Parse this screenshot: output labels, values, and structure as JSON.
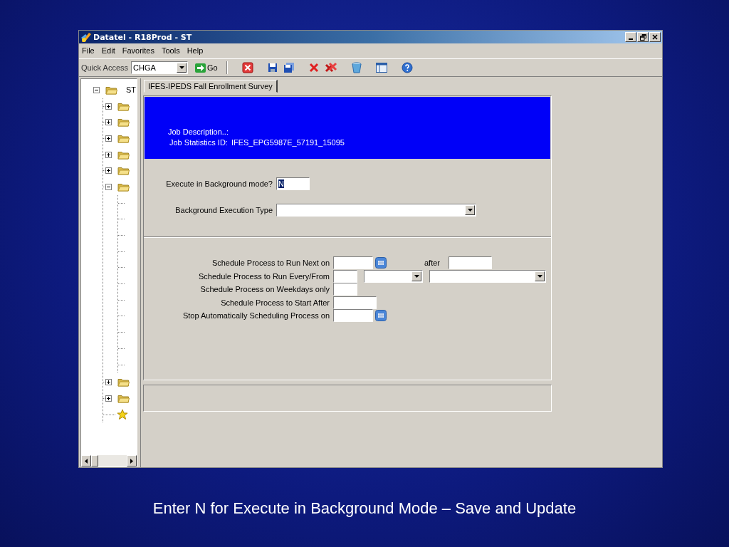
{
  "window": {
    "title": "Datatel - R18Prod - ST"
  },
  "menu": [
    {
      "label": "File"
    },
    {
      "label": "Edit"
    },
    {
      "label": "Favorites"
    },
    {
      "label": "Tools"
    },
    {
      "label": "Help"
    }
  ],
  "toolbar": {
    "quick_access_label": "Quick Access",
    "quick_access_value": "CHGA",
    "go_label": "Go"
  },
  "tree": {
    "label": "ST",
    "kind": "folder",
    "expanded": true,
    "children": [
      {
        "kind": "folder",
        "expanded": false
      },
      {
        "kind": "folder",
        "expanded": false
      },
      {
        "kind": "folder",
        "expanded": false
      },
      {
        "kind": "folder",
        "expanded": false
      },
      {
        "kind": "folder",
        "expanded": false
      },
      {
        "kind": "folder",
        "expanded": true,
        "children": [
          {
            "kind": "leaf"
          },
          {
            "kind": "leaf"
          },
          {
            "kind": "leaf"
          },
          {
            "kind": "leaf"
          },
          {
            "kind": "leaf"
          },
          {
            "kind": "leaf"
          },
          {
            "kind": "leaf"
          },
          {
            "kind": "leaf"
          },
          {
            "kind": "leaf"
          },
          {
            "kind": "leaf"
          },
          {
            "kind": "leaf"
          }
        ]
      },
      {
        "kind": "folder",
        "expanded": false
      },
      {
        "kind": "folder",
        "expanded": false
      },
      {
        "kind": "favorite"
      }
    ]
  },
  "tabs": [
    {
      "label": "IFES-IPEDS Fall Enrollment Survey",
      "selected": true
    }
  ],
  "header": {
    "job_description_label": "Job Description..:",
    "job_statistics_label": "Job Statistics ID:",
    "job_statistics_id": "IFES_EPG5987E_57191_15095"
  },
  "background": {
    "execute_label": "Execute in Background mode?",
    "execute_value": "N",
    "type_label": "Background Execution Type"
  },
  "schedule": [
    {
      "label": "Schedule Process to Run Next on",
      "fields": [
        {
          "kind": "date"
        },
        {
          "kind": "text",
          "text": "after"
        },
        {
          "kind": "time"
        }
      ]
    },
    {
      "label": "Schedule Process to Run Every/From",
      "fields": [
        {
          "kind": "number"
        },
        {
          "kind": "select"
        },
        {
          "kind": "long_select"
        }
      ]
    },
    {
      "label": "Schedule Process on Weekdays only",
      "fields": [
        {
          "kind": "number"
        }
      ]
    },
    {
      "label": "Schedule Process to Start After",
      "fields": [
        {
          "kind": "time"
        }
      ]
    },
    {
      "label": "Stop Automatically Scheduling Process on",
      "fields": [
        {
          "kind": "date"
        }
      ]
    }
  ],
  "caption": "Enter N for Execute in Background Mode – Save and Update"
}
